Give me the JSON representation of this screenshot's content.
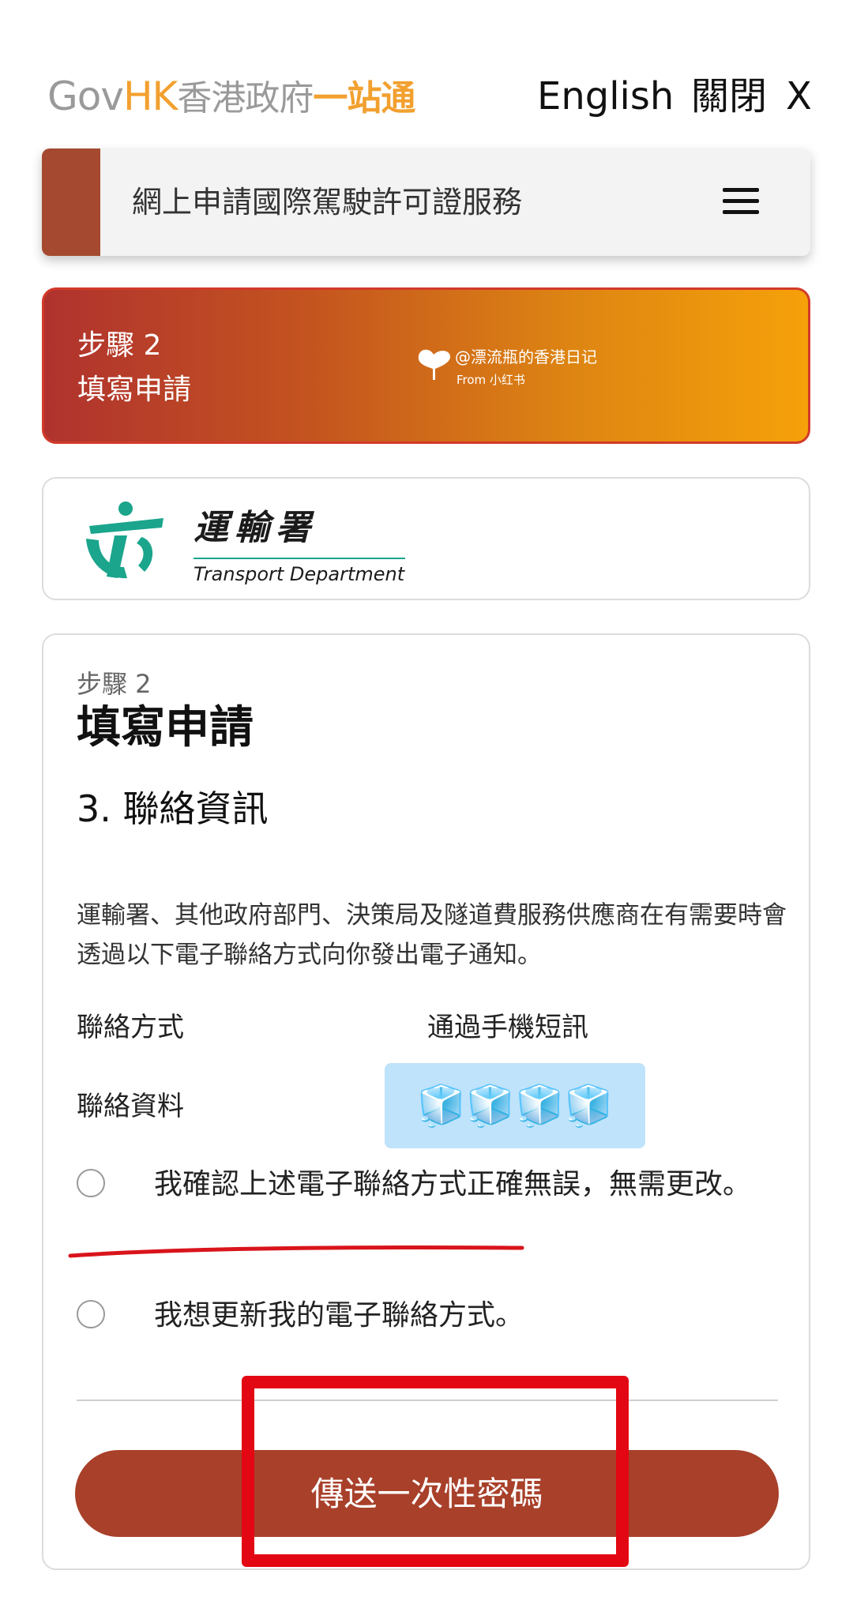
{
  "header": {
    "logo_gov": "Gov",
    "logo_hk": "HK",
    "logo_zh": "香港政府",
    "logo_yz": "一站通",
    "language": "English",
    "close": "關閉",
    "close_x": "X"
  },
  "service": {
    "title": "網上申請國際駕駛許可證服務",
    "menu_icon": "hamburger-icon"
  },
  "banner": {
    "step": "步驟 2",
    "name": "填寫申請",
    "watermark": "@漂流瓶的香港日记",
    "watermark_from": "From 小红书"
  },
  "department": {
    "name_zh": "運輸署",
    "name_en": "Transport Department"
  },
  "form": {
    "step": "步驟 2",
    "title": "填寫申請",
    "section": "3. 聯絡資訊",
    "description": "運輸署、其他政府部門、決策局及隧道費服務供應商在有需要時會透過以下電子聯絡方式向你發出電子通知。",
    "contact_method_label": "聯絡方式",
    "contact_method_value": "通過手機短訊",
    "contact_info_label": "聯絡資料",
    "contact_info_value": "🧊🧊🧊🧊",
    "option_confirm": "我確認上述電子聯絡方式正確無誤，無需更改。",
    "option_update": "我想更新我的電子聯絡方式。",
    "send_button": "傳送一次性密碼"
  },
  "colors": {
    "brand_orange": "#f2a02f",
    "button_brown": "#a8402a",
    "annotation_red": "#e30613",
    "td_green": "#1aa58c"
  }
}
